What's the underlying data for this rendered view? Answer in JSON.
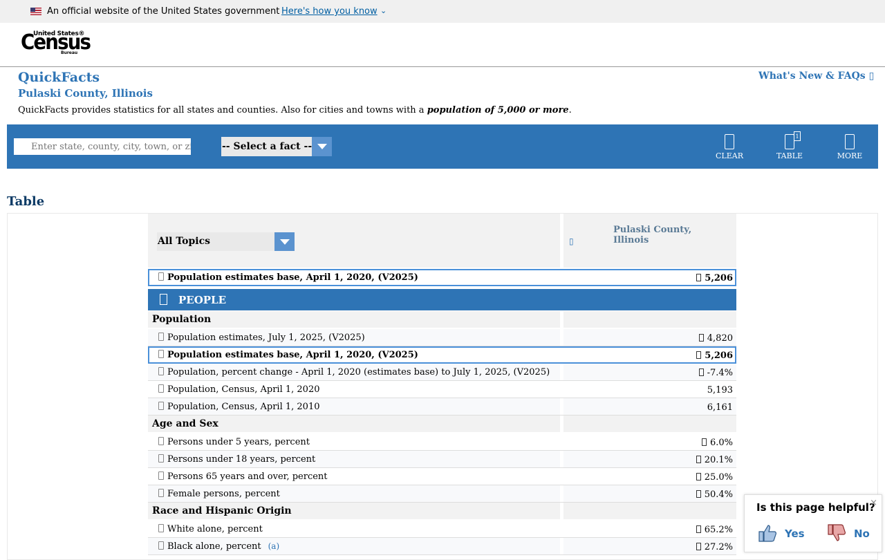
{
  "gov_banner": {
    "text": "An official website of the United States government",
    "link": "Here's how you know"
  },
  "logo": {
    "top": "United States®",
    "main": "Census",
    "sub": "Bureau"
  },
  "quickfacts": {
    "title": "QuickFacts",
    "subtitle": "Pulaski County, Illinois",
    "description": "QuickFacts provides statistics for all states and counties. Also for cities and towns with a ",
    "description_bold": "population of 5,000 or more",
    "description_end": ".",
    "whats_new": "What's New & FAQs "
  },
  "toolbar": {
    "search_placeholder": "Enter state, county, city, town, or zip code",
    "select_fact": "-- Select a fact --",
    "buttons": {
      "clear": "CLEAR",
      "table": "TABLE",
      "table_count": "1",
      "more": "MORE"
    }
  },
  "table_heading": "Table",
  "table": {
    "topics_select": "All Topics",
    "column_header": "Pulaski County, Illinois",
    "pinned_row": {
      "label": "Population estimates base, April 1, 2020, (V2025)",
      "value": "5,206"
    },
    "section": "PEOPLE",
    "rows": [
      {
        "type": "category",
        "label": "Population"
      },
      {
        "label": "Population estimates, July 1, 2025, (V2025)",
        "value": "4,820",
        "flag": true
      },
      {
        "label": "Population estimates base, April 1, 2020, (V2025)",
        "value": "5,206",
        "flag": true,
        "highlight": true
      },
      {
        "label": "Population, percent change - April 1, 2020 (estimates base) to July 1, 2025, (V2025)",
        "value": "-7.4%",
        "flag": true
      },
      {
        "label": "Population, Census, April 1, 2020",
        "value": "5,193"
      },
      {
        "label": "Population, Census, April 1, 2010",
        "value": "6,161"
      },
      {
        "type": "category",
        "label": "Age and Sex"
      },
      {
        "label": "Persons under 5 years, percent",
        "value": "6.0%",
        "flag": true
      },
      {
        "label": "Persons under 18 years, percent",
        "value": "20.1%",
        "flag": true
      },
      {
        "label": "Persons 65 years and over, percent",
        "value": "25.0%",
        "flag": true
      },
      {
        "label": "Female persons, percent",
        "value": "50.4%",
        "flag": true
      },
      {
        "type": "category",
        "label": "Race and Hispanic Origin"
      },
      {
        "label": "White alone, percent",
        "value": "65.2%",
        "flag": true
      },
      {
        "label": "Black alone, percent",
        "note": "(a)",
        "value": "27.2%",
        "flag": true
      }
    ]
  },
  "feedback": {
    "question": "Is this page helpful?",
    "yes": "Yes",
    "no": "No",
    "close": "×"
  }
}
